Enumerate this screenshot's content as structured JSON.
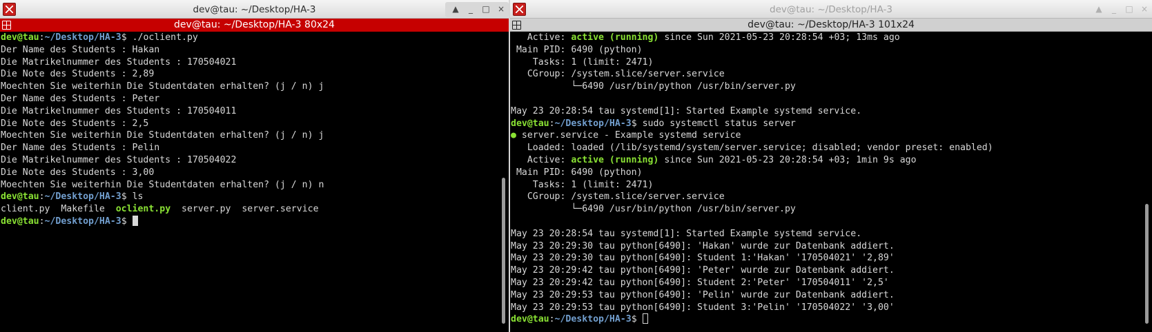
{
  "left_window": {
    "title": "dev@tau: ~/Desktop/HA-3",
    "tab_title": "dev@tau: ~/Desktop/HA-3 80x24",
    "controls": {
      "scroll_up": "▲",
      "minimize": "_",
      "maximize": "□",
      "close": "×"
    },
    "lines": [
      {
        "user": "dev@tau",
        "path": "~/Desktop/HA-3",
        "rest": "$ ./oclient.py"
      },
      {
        "text": "Der Name des Students : Hakan"
      },
      {
        "text": "Die Matrikelnummer des Students : 170504021"
      },
      {
        "text": "Die Note des Students : 2,89"
      },
      {
        "text": "Moechten Sie weiterhin Die Studentdaten erhalten? (j / n) j"
      },
      {
        "text": "Der Name des Students : Peter"
      },
      {
        "text": "Die Matrikelnummer des Students : 170504011"
      },
      {
        "text": "Die Note des Students : 2,5"
      },
      {
        "text": "Moechten Sie weiterhin Die Studentdaten erhalten? (j / n) j"
      },
      {
        "text": "Der Name des Students : Pelin"
      },
      {
        "text": "Die Matrikelnummer des Students : 170504022"
      },
      {
        "text": "Die Note des Students : 3,00"
      },
      {
        "text": "Moechten Sie weiterhin Die Studentdaten erhalten? (j / n) n"
      },
      {
        "user": "dev@tau",
        "path": "~/Desktop/HA-3",
        "rest": "$ ls"
      },
      {
        "pre": "client.py  Makefile  ",
        "hl": "oclient.py",
        "post": "  server.py  server.service"
      },
      {
        "user": "dev@tau",
        "path": "~/Desktop/HA-3",
        "rest": "$ ",
        "cursor": true
      }
    ]
  },
  "right_window": {
    "title": "dev@tau: ~/Desktop/HA-3",
    "tab_title": "dev@tau: ~/Desktop/HA-3 101x24",
    "controls": {
      "scroll_up": "▲",
      "minimize": "_",
      "maximize": "□",
      "close": "×"
    },
    "lines": [
      {
        "pre": "   Active: ",
        "hl": "active (running)",
        "post": " since Sun 2021-05-23 20:28:54 +03; 13ms ago"
      },
      {
        "text": " Main PID: 6490 (python)"
      },
      {
        "text": "    Tasks: 1 (limit: 2471)"
      },
      {
        "text": "   CGroup: /system.slice/server.service"
      },
      {
        "text": "           └─6490 /usr/bin/python /usr/bin/server.py"
      },
      {
        "text": ""
      },
      {
        "text": "May 23 20:28:54 tau systemd[1]: Started Example systemd service."
      },
      {
        "user": "dev@tau",
        "path": "~/Desktop/HA-3",
        "rest": "$ sudo systemctl status server"
      },
      {
        "hl": "●",
        "post": " server.service - Example systemd service"
      },
      {
        "text": "   Loaded: loaded (/lib/systemd/system/server.service; disabled; vendor preset: enabled)"
      },
      {
        "pre": "   Active: ",
        "hl": "active (running)",
        "post": " since Sun 2021-05-23 20:28:54 +03; 1min 9s ago"
      },
      {
        "text": " Main PID: 6490 (python)"
      },
      {
        "text": "    Tasks: 1 (limit: 2471)"
      },
      {
        "text": "   CGroup: /system.slice/server.service"
      },
      {
        "text": "           └─6490 /usr/bin/python /usr/bin/server.py"
      },
      {
        "text": ""
      },
      {
        "text": "May 23 20:28:54 tau systemd[1]: Started Example systemd service."
      },
      {
        "text": "May 23 20:29:30 tau python[6490]: 'Hakan' wurde zur Datenbank addiert."
      },
      {
        "text": "May 23 20:29:30 tau python[6490]: Student 1:'Hakan' '170504021' '2,89'"
      },
      {
        "text": "May 23 20:29:42 tau python[6490]: 'Peter' wurde zur Datenbank addiert."
      },
      {
        "text": "May 23 20:29:42 tau python[6490]: Student 2:'Peter' '170504011' '2,5'"
      },
      {
        "text": "May 23 20:29:53 tau python[6490]: 'Pelin' wurde zur Datenbank addiert."
      },
      {
        "text": "May 23 20:29:53 tau python[6490]: Student 3:'Pelin' '170504022' '3,00'"
      },
      {
        "user": "dev@tau",
        "path": "~/Desktop/HA-3",
        "rest": "$ ",
        "cursor": "hollow"
      }
    ]
  },
  "colors": {
    "tab_active": "#c60000",
    "prompt_user": "#8ae234",
    "prompt_path": "#729fcf",
    "highlight": "#8ae234",
    "text": "#d8d8d8"
  },
  "icons": {
    "app": "terminal-app-icon",
    "tab": "tab-grid-icon"
  }
}
